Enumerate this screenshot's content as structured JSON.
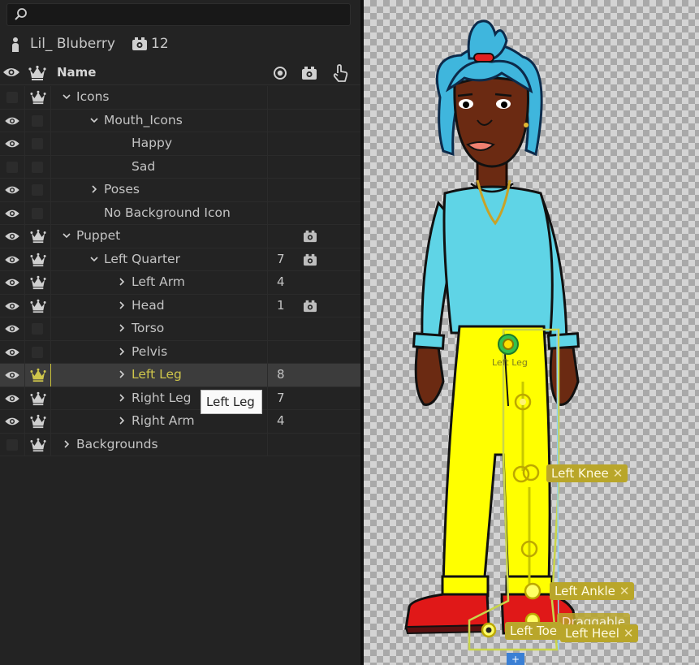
{
  "search": {
    "value": "",
    "placeholder": ""
  },
  "puppet": {
    "name": "Lil_ Bluberry",
    "camera_count": "12"
  },
  "header": {
    "name_label": "Name"
  },
  "layers": [
    {
      "label": "Icons",
      "depth": 0,
      "expander": "open",
      "eye": false,
      "crown": true,
      "num": "",
      "cam": false
    },
    {
      "label": "Mouth_Icons",
      "depth": 1,
      "expander": "open",
      "eye": true,
      "crown": false,
      "num": "",
      "cam": false
    },
    {
      "label": "Happy",
      "depth": 2,
      "expander": "none",
      "eye": true,
      "crown": false,
      "num": "",
      "cam": false
    },
    {
      "label": "Sad",
      "depth": 2,
      "expander": "none",
      "eye": false,
      "crown": false,
      "num": "",
      "cam": false
    },
    {
      "label": "Poses",
      "depth": 1,
      "expander": "closed",
      "eye": true,
      "crown": false,
      "num": "",
      "cam": false
    },
    {
      "label": "No Background Icon",
      "depth": 1,
      "expander": "none",
      "eye": true,
      "crown": false,
      "num": "",
      "cam": false
    },
    {
      "label": "Puppet",
      "depth": 0,
      "expander": "open",
      "eye": true,
      "crown": true,
      "num": "",
      "cam": true
    },
    {
      "label": "Left Quarter",
      "depth": 1,
      "expander": "open",
      "eye": true,
      "crown": true,
      "num": "7",
      "cam": true
    },
    {
      "label": "Left Arm",
      "depth": 2,
      "expander": "closed",
      "eye": true,
      "crown": true,
      "num": "4",
      "cam": false
    },
    {
      "label": "Head",
      "depth": 2,
      "expander": "closed",
      "eye": true,
      "crown": true,
      "num": "1",
      "cam": true
    },
    {
      "label": "Torso",
      "depth": 2,
      "expander": "closed",
      "eye": true,
      "crown": false,
      "num": "",
      "cam": false
    },
    {
      "label": "Pelvis",
      "depth": 2,
      "expander": "closed",
      "eye": true,
      "crown": false,
      "num": "",
      "cam": false
    },
    {
      "label": "Left Leg",
      "depth": 2,
      "expander": "closed",
      "eye": true,
      "crown": true,
      "num": "8",
      "cam": false,
      "selected": true
    },
    {
      "label": "Right Leg",
      "depth": 2,
      "expander": "closed",
      "eye": true,
      "crown": true,
      "num": "7",
      "cam": false
    },
    {
      "label": "Right Arm",
      "depth": 2,
      "expander": "closed",
      "eye": true,
      "crown": true,
      "num": "4",
      "cam": false
    },
    {
      "label": "Backgrounds",
      "depth": 0,
      "expander": "closed",
      "eye": false,
      "crown": true,
      "num": "",
      "cam": false
    }
  ],
  "tooltip": {
    "text": "Left Leg"
  },
  "canvas": {
    "handle_label": "Left Leg",
    "tags": {
      "knee": "Left Knee",
      "ankle": "Left Ankle",
      "draggable": "Draggable",
      "toe": "Left Toe",
      "heel": "Left Heel"
    },
    "close_glyph": "✕"
  },
  "colors": {
    "panel_bg": "#232323",
    "selected_row": "#3c3c3c",
    "accent_yellow": "#cfc64b",
    "tag_bg": "#b9a62a"
  }
}
